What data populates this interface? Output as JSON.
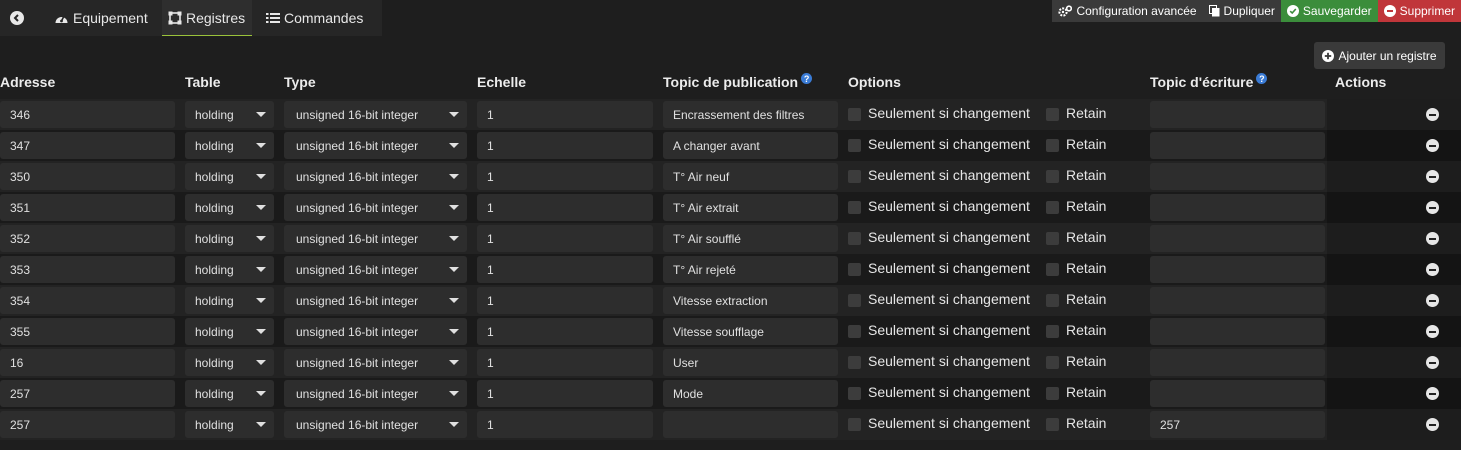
{
  "tabs": [
    {
      "label": "Equipement",
      "icon": "dashboard-icon"
    },
    {
      "label": "Registres",
      "icon": "registers-icon"
    },
    {
      "label": "Commandes",
      "icon": "list-icon"
    }
  ],
  "toolbar": {
    "advanced_label": "Configuration avancée",
    "duplicate_label": "Dupliquer",
    "save_label": "Sauvegarder",
    "delete_label": "Supprimer",
    "add_register_label": "Ajouter un registre"
  },
  "colors": {
    "save": "#3b8d3b",
    "delete": "#c0363a",
    "active_tab_underline": "#9ac23a",
    "help": "#3a7bd5"
  },
  "columns": {
    "address": "Adresse",
    "table": "Table",
    "type": "Type",
    "scale": "Echelle",
    "publish_topic": "Topic de publication",
    "options": "Options",
    "write_topic": "Topic d'écriture",
    "actions": "Actions"
  },
  "help_glyph": "?",
  "option_labels": {
    "only_on_change": "Seulement si changement",
    "retain": "Retain"
  },
  "rows": [
    {
      "address": "346",
      "table": "holding",
      "type": "unsigned 16-bit integer",
      "scale": "1",
      "publish_topic": "Encrassement des filtres",
      "write_topic": ""
    },
    {
      "address": "347",
      "table": "holding",
      "type": "unsigned 16-bit integer",
      "scale": "1",
      "publish_topic": "A changer avant",
      "write_topic": ""
    },
    {
      "address": "350",
      "table": "holding",
      "type": "unsigned 16-bit integer",
      "scale": "1",
      "publish_topic": "T° Air neuf",
      "write_topic": ""
    },
    {
      "address": "351",
      "table": "holding",
      "type": "unsigned 16-bit integer",
      "scale": "1",
      "publish_topic": "T° Air extrait",
      "write_topic": ""
    },
    {
      "address": "352",
      "table": "holding",
      "type": "unsigned 16-bit integer",
      "scale": "1",
      "publish_topic": "T° Air soufflé",
      "write_topic": ""
    },
    {
      "address": "353",
      "table": "holding",
      "type": "unsigned 16-bit integer",
      "scale": "1",
      "publish_topic": "T° Air rejeté",
      "write_topic": ""
    },
    {
      "address": "354",
      "table": "holding",
      "type": "unsigned 16-bit integer",
      "scale": "1",
      "publish_topic": "Vitesse extraction",
      "write_topic": ""
    },
    {
      "address": "355",
      "table": "holding",
      "type": "unsigned 16-bit integer",
      "scale": "1",
      "publish_topic": "Vitesse soufflage",
      "write_topic": ""
    },
    {
      "address": "16",
      "table": "holding",
      "type": "unsigned 16-bit integer",
      "scale": "1",
      "publish_topic": "User",
      "write_topic": ""
    },
    {
      "address": "257",
      "table": "holding",
      "type": "unsigned 16-bit integer",
      "scale": "1",
      "publish_topic": "Mode",
      "write_topic": ""
    },
    {
      "address": "257",
      "table": "holding",
      "type": "unsigned 16-bit integer",
      "scale": "1",
      "publish_topic": "",
      "write_topic": "257"
    }
  ]
}
